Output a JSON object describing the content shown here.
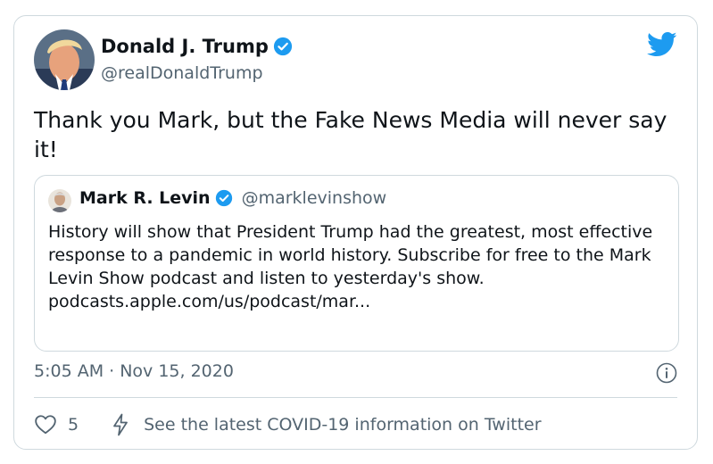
{
  "author": {
    "name": "Donald J. Trump",
    "handle": "@realDonaldTrump",
    "verified": true
  },
  "tweet": {
    "text": "Thank you Mark, but the Fake News Media will never say it!"
  },
  "quoted_tweet": {
    "name": "Mark R. Levin",
    "handle": "@marklevinshow",
    "verified": true,
    "text": "History will show that President Trump had the greatest, most effective response to a pandemic in world history. Subscribe for free to the Mark Levin Show podcast and listen to yesterday's show.",
    "link": "podcasts.apple.com/us/podcast/mar..."
  },
  "meta": {
    "timestamp": "5:05 AM · Nov 15, 2020"
  },
  "actions": {
    "like_count": "5",
    "covid_label": "See the latest COVID-19 information on Twitter"
  },
  "icons": {
    "logo": "twitter-bird-icon",
    "verified": "verified-badge-icon",
    "info": "info-icon",
    "like": "heart-icon",
    "covid": "lightning-bolt-icon"
  },
  "colors": {
    "brand": "#1d9bf0",
    "text": "#0f1419",
    "secondary": "#536471",
    "border": "#cfd9de"
  }
}
